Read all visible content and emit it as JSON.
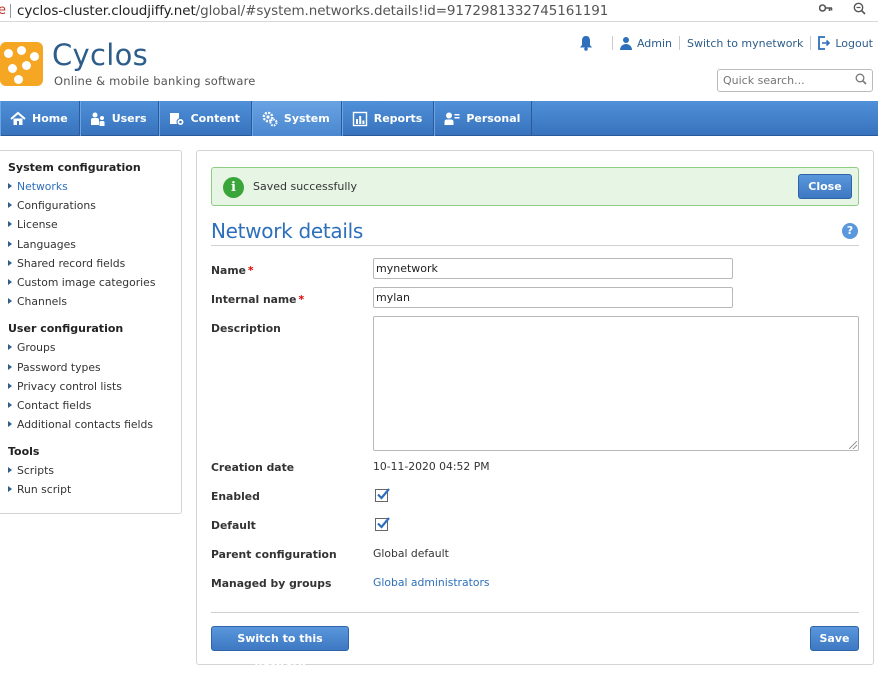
{
  "browser": {
    "url_host": "cyclos-cluster.cloudjiffy.net",
    "url_path": "/global/#system.networks.details!id=9172981332745161191",
    "key_icon": "key-icon",
    "zoom_icon": "zoom-icon"
  },
  "header": {
    "logo_title": "Cyclos",
    "logo_subtitle": "Online & mobile banking software",
    "links": {
      "admin": "Admin",
      "switch": "Switch to mynetwork",
      "logout": "Logout"
    },
    "search_placeholder": "Quick search..."
  },
  "nav": [
    {
      "label": "Home",
      "icon": "home-icon"
    },
    {
      "label": "Users",
      "icon": "users-icon"
    },
    {
      "label": "Content",
      "icon": "content-icon"
    },
    {
      "label": "System",
      "icon": "gear-icon",
      "active": true
    },
    {
      "label": "Reports",
      "icon": "chart-icon"
    },
    {
      "label": "Personal",
      "icon": "personal-icon"
    }
  ],
  "sidebar": {
    "sections": [
      {
        "title": "System configuration",
        "items": [
          "Networks",
          "Configurations",
          "License",
          "Languages",
          "Shared record fields",
          "Custom image categories",
          "Channels"
        ]
      },
      {
        "title": "User configuration",
        "items": [
          "Groups",
          "Password types",
          "Privacy control lists",
          "Contact fields",
          "Additional contacts fields"
        ]
      },
      {
        "title": "Tools",
        "items": [
          "Scripts",
          "Run script"
        ]
      }
    ],
    "active": "Networks"
  },
  "alert": {
    "message": "Saved successfully",
    "close_label": "Close"
  },
  "page": {
    "title": "Network details",
    "help": "?"
  },
  "form": {
    "name_label": "Name",
    "name_value": "mynetwork",
    "internal_name_label": "Internal name",
    "internal_name_value": "mylan",
    "required_mark": "*",
    "description_label": "Description",
    "description_value": "",
    "creation_date_label": "Creation date",
    "creation_date_value": "10-11-2020 04:52 PM",
    "enabled_label": "Enabled",
    "enabled_checked": true,
    "default_label": "Default",
    "default_checked": true,
    "parent_config_label": "Parent configuration",
    "parent_config_value": "Global default",
    "managed_by_label": "Managed by groups",
    "managed_by_value": "Global administrators"
  },
  "buttons": {
    "switch_label": "Switch to this network",
    "save_label": "Save"
  },
  "colors": {
    "brand_blue": "#2d6fbb",
    "nav_blue": "#3873bd",
    "logo_orange": "#f5a623",
    "success_bg": "#e7f6e4",
    "success_icon": "#3aa53a",
    "required_red": "#dd0000"
  }
}
